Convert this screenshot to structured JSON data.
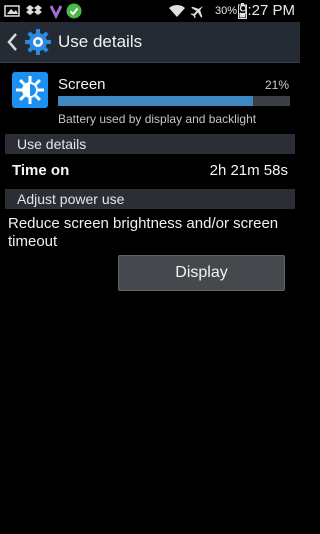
{
  "status_bar": {
    "left_icons": [
      "gallery-icon",
      "dropbox-icon",
      "viber-icon",
      "check-icon"
    ],
    "battery_percent": "30%",
    "time": "9:27 PM"
  },
  "action_bar": {
    "title": "Use details"
  },
  "usage_item": {
    "name": "Screen",
    "percent": "21%",
    "fraction": 0.84,
    "description": "Battery used by display and backlight"
  },
  "use_details": {
    "header": "Use details",
    "time_on_label": "Time on",
    "time_on_value": "2h 21m 58s"
  },
  "adjust_power": {
    "header": "Adjust power use",
    "text": "Reduce screen brightness and/or screen timeout",
    "button_label": "Display"
  },
  "colors": {
    "action_bar_bg": "#242b35",
    "progress_fill": "#3f87c2",
    "screen_icon_bg": "#1d8ff0"
  }
}
